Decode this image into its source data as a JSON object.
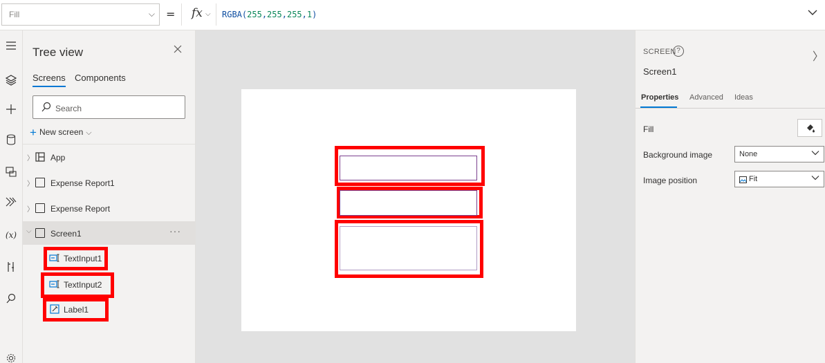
{
  "formula_bar": {
    "property": "Fill",
    "equals": "=",
    "fx": "fx",
    "formula_prefix": "RGBA(",
    "formula_args": [
      "255",
      "255",
      "255",
      "1"
    ],
    "formula_suffix": ")"
  },
  "tree_view": {
    "title": "Tree view",
    "tabs": [
      "Screens",
      "Components"
    ],
    "active_tab": "Screens",
    "search_placeholder": "Search",
    "new_screen_label": "New screen",
    "items": [
      {
        "label": "App",
        "icon": "app-icon"
      },
      {
        "label": "Expense Report1",
        "icon": "screen-icon"
      },
      {
        "label": "Expense Report",
        "icon": "screen-icon"
      },
      {
        "label": "Screen1",
        "icon": "screen-icon",
        "selected": true,
        "more": "···"
      }
    ],
    "children": [
      {
        "label": "TextInput1",
        "icon": "text-input-icon"
      },
      {
        "label": "TextInput2",
        "icon": "text-input-icon"
      },
      {
        "label": "Label1",
        "icon": "label-icon"
      }
    ]
  },
  "properties_panel": {
    "kind": "SCREEN",
    "help": "?",
    "name": "Screen1",
    "tabs": [
      "Properties",
      "Advanced",
      "Ideas"
    ],
    "active_tab": "Properties",
    "rows": [
      {
        "label": "Fill"
      },
      {
        "label": "Background image",
        "value": "None"
      },
      {
        "label": "Image position",
        "value": "Fit"
      }
    ]
  },
  "colors": {
    "accent": "#0078d4",
    "highlight": "#ff0000",
    "control_border": "#7a3f8e"
  }
}
